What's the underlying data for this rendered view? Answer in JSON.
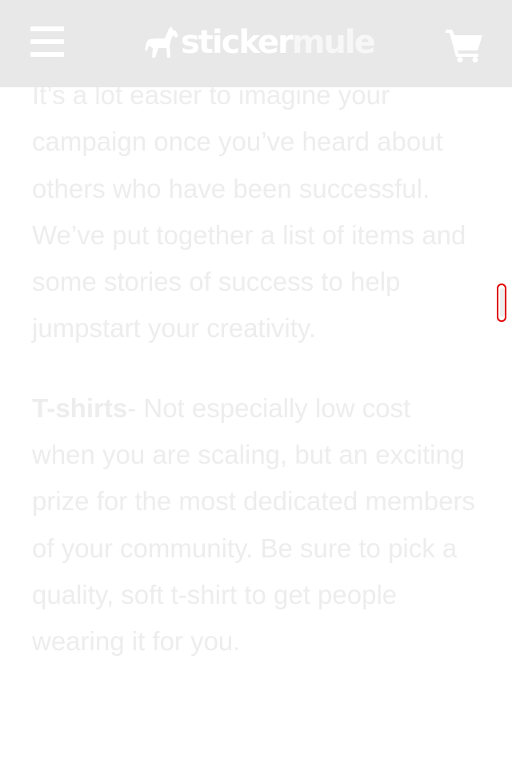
{
  "header": {
    "brand_part1": "sticker",
    "brand_part2": "mule",
    "menu_icon": "hamburger-menu-icon",
    "cart_icon": "shopping-cart-icon",
    "background_color": "#e8e8e8"
  },
  "article": {
    "intro": "It’s a lot easier to imagine your campaign once you’ve heard about others who have been successful. We’ve put together a list of items and some stories of success to help jumpstart your creativity.",
    "tshirts_title": "T-shirts",
    "tshirts_text": "- Not especially low cost when you are scaling, but an exciting prize for the most dedicated members of your community. Be sure to pick a quality, soft t-shirt to get people wearing it for you."
  },
  "scroll_indicator": {
    "icon": "scroll-handle-icon",
    "accent_color": "#e00000"
  }
}
